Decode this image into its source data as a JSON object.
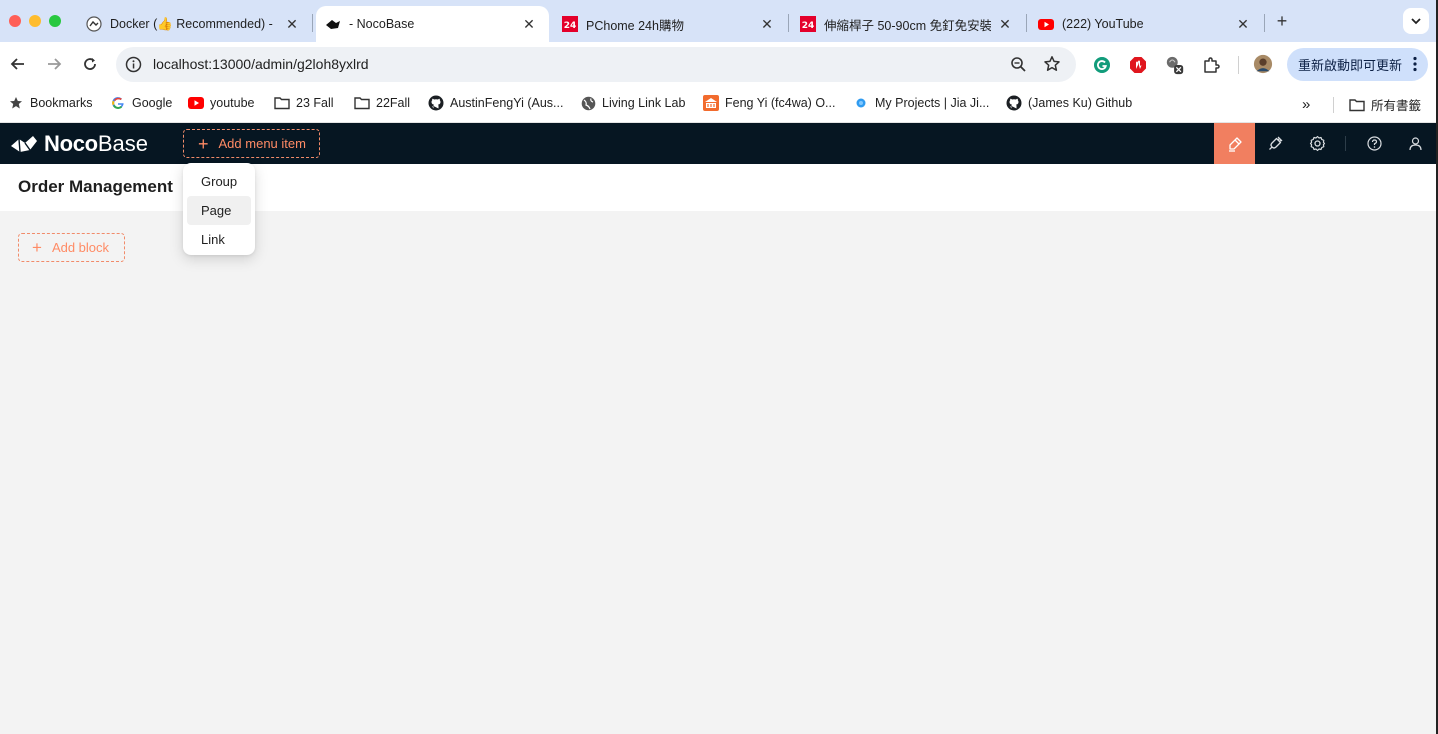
{
  "browser": {
    "tabs": [
      {
        "title": "Docker (👍 Recommended) -",
        "favicon": "nocobase-doc-icon"
      },
      {
        "title": "- NocoBase",
        "favicon": "nocobase-icon",
        "active": true
      },
      {
        "title": "PChome 24h購物",
        "favicon": "pchome-icon"
      },
      {
        "title": "伸縮桿子 50-90cm 免釘免安裝",
        "favicon": "pchome-icon"
      },
      {
        "title": "(222) YouTube",
        "favicon": "youtube-icon"
      }
    ],
    "url": "localhost:13000/admin/g2loh8yxlrd",
    "update_button": "重新啟動即可更新",
    "bookmarks": [
      {
        "label": "Bookmarks",
        "icon": "star-icon"
      },
      {
        "label": "Google",
        "icon": "google-icon"
      },
      {
        "label": "youtube",
        "icon": "youtube-icon"
      },
      {
        "label": "23 Fall",
        "icon": "folder-icon"
      },
      {
        "label": "22Fall",
        "icon": "folder-icon"
      },
      {
        "label": "AustinFengYi (Aus...",
        "icon": "github-icon"
      },
      {
        "label": "Living Link Lab",
        "icon": "globe-icon"
      },
      {
        "label": "Feng Yi (fc4wa) O...",
        "icon": "building-icon"
      },
      {
        "label": "My Projects | Jia Ji...",
        "icon": "dot-icon"
      },
      {
        "label": "(James Ku) Github",
        "icon": "github-icon"
      }
    ],
    "all_bookmarks": "所有書籤"
  },
  "app": {
    "logo_bold": "Noco",
    "logo_light": "Base",
    "add_menu_item": "Add menu item",
    "page_title": "Order Management",
    "add_block": "Add block",
    "menu_dropdown": [
      "Group",
      "Page",
      "Link"
    ],
    "hovered_item": "Page",
    "accent_color": "#f17f60",
    "header_bg": "#061622"
  }
}
